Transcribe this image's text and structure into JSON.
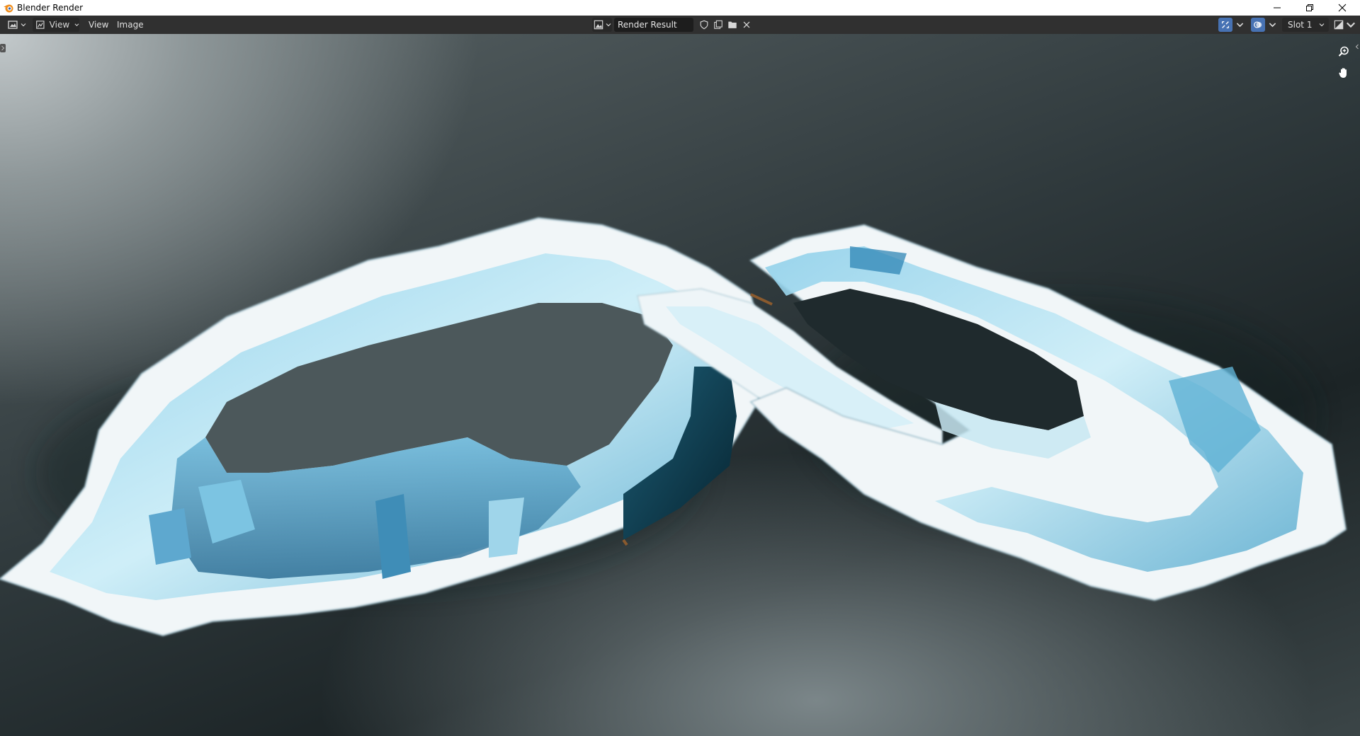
{
  "window": {
    "title": "Blender Render",
    "controls": [
      "minimize-icon",
      "restore-icon",
      "close-icon"
    ]
  },
  "header": {
    "editor_type_icon": "image-editor-icon",
    "mode": {
      "label": "View",
      "icon": "view-icon"
    },
    "menus": [
      {
        "label": "View"
      },
      {
        "label": "Image"
      }
    ],
    "image_browse_icon": "image-browse-icon",
    "image_name": "Render Result",
    "image_actions": [
      "fake-user-shield-icon",
      "duplicate-image-icon",
      "open-folder-icon",
      "unlink-x-icon"
    ],
    "right_tools": [
      {
        "icon": "uv-sync-icon",
        "active": true
      },
      {
        "icon": "overlay-icon",
        "active": true
      },
      {
        "icon": "display-channels-icon",
        "active": false
      }
    ],
    "slot": "Slot 1"
  },
  "viewport": {
    "content": "render-result",
    "tools": [
      "zoom-icon",
      "pan-hand-icon"
    ]
  },
  "colors": {
    "header_bg": "#303030",
    "field_bg": "#1d1d1d",
    "accent_blue": "#4772b3",
    "ice": "#bfe4f2",
    "snow": "#f2f6f8",
    "water": "#0e3a4b"
  }
}
